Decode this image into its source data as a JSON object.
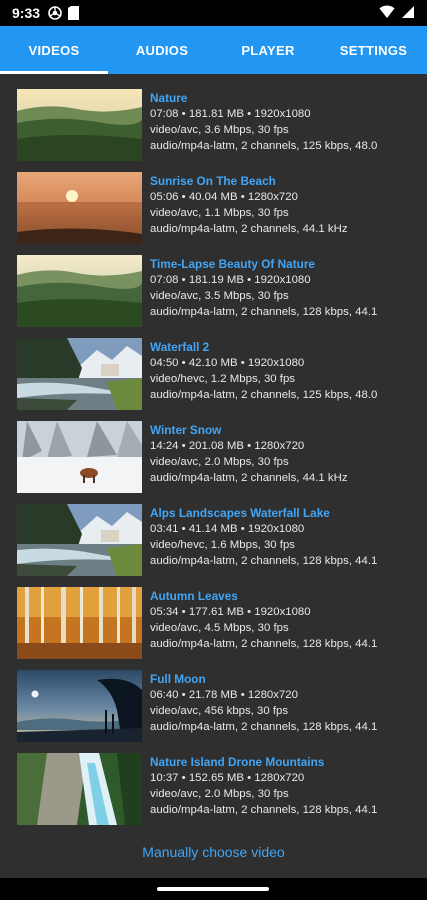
{
  "status": {
    "time": "9:33"
  },
  "tabs": [
    {
      "label": "VIDEOS"
    },
    {
      "label": "AUDIOS"
    },
    {
      "label": "PLAYER"
    },
    {
      "label": "SETTINGS"
    }
  ],
  "videos": [
    {
      "title": "Nature",
      "meta": "07:08 • 181.81 MB • 1920x1080",
      "video": "video/avc, 3.6 Mbps, 30 fps",
      "audio": "audio/mp4a-latm, 2 channels, 125 kbps, 48.0"
    },
    {
      "title": "Sunrise On The Beach",
      "meta": "05:06 • 40.04 MB • 1280x720",
      "video": "video/avc, 1.1 Mbps, 30 fps",
      "audio": "audio/mp4a-latm, 2 channels, 44.1 kHz"
    },
    {
      "title": "Time-Lapse Beauty Of Nature",
      "meta": "07:08 • 181.19 MB • 1920x1080",
      "video": "video/avc, 3.5 Mbps, 30 fps",
      "audio": "audio/mp4a-latm, 2 channels, 128 kbps, 44.1"
    },
    {
      "title": "Waterfall 2",
      "meta": "04:50 • 42.10 MB • 1920x1080",
      "video": "video/hevc, 1.2 Mbps, 30 fps",
      "audio": "audio/mp4a-latm, 2 channels, 125 kbps, 48.0"
    },
    {
      "title": "Winter Snow",
      "meta": "14:24 • 201.08 MB • 1280x720",
      "video": "video/avc, 2.0 Mbps, 30 fps",
      "audio": "audio/mp4a-latm, 2 channels, 44.1 kHz"
    },
    {
      "title": "Alps Landscapes Waterfall Lake",
      "meta": "03:41 • 41.14 MB • 1920x1080",
      "video": "video/hevc, 1.6 Mbps, 30 fps",
      "audio": "audio/mp4a-latm, 2 channels, 128 kbps, 44.1"
    },
    {
      "title": "Autumn Leaves",
      "meta": "05:34 • 177.61 MB • 1920x1080",
      "video": "video/avc, 4.5 Mbps, 30 fps",
      "audio": "audio/mp4a-latm, 2 channels, 128 kbps, 44.1"
    },
    {
      "title": "Full Moon",
      "meta": "06:40 • 21.78 MB • 1280x720",
      "video": "video/avc, 456 kbps, 30 fps",
      "audio": "audio/mp4a-latm, 2 channels, 128 kbps, 44.1"
    },
    {
      "title": "Nature Island Drone Mountains",
      "meta": "10:37 • 152.65 MB • 1280x720",
      "video": "video/avc, 2.0 Mbps, 30 fps",
      "audio": "audio/mp4a-latm, 2 channels, 128 kbps, 44.1"
    }
  ],
  "manual_choose": "Manually choose video",
  "colors": {
    "accent": "#2196F3",
    "link": "#42a5f5",
    "background": "#2f2f2f"
  },
  "icons": [
    "chrome-icon",
    "file-icon",
    "wifi-icon",
    "battery-icon"
  ]
}
